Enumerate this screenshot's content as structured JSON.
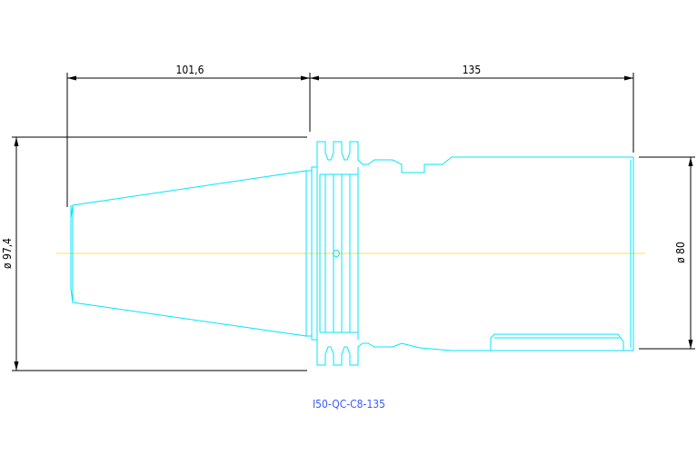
{
  "drawing": {
    "part_label": "I50-QC-C8-135",
    "label_color": "#3b5bff",
    "outline_color": "#00e5ff",
    "centerline_color": "#ffe14d",
    "dimension_color": "#000000"
  },
  "dimensions": {
    "taper_length": "101,6",
    "body_length": "135",
    "flange_diameter": "ø 97,4",
    "body_diameter": "ø 80"
  }
}
